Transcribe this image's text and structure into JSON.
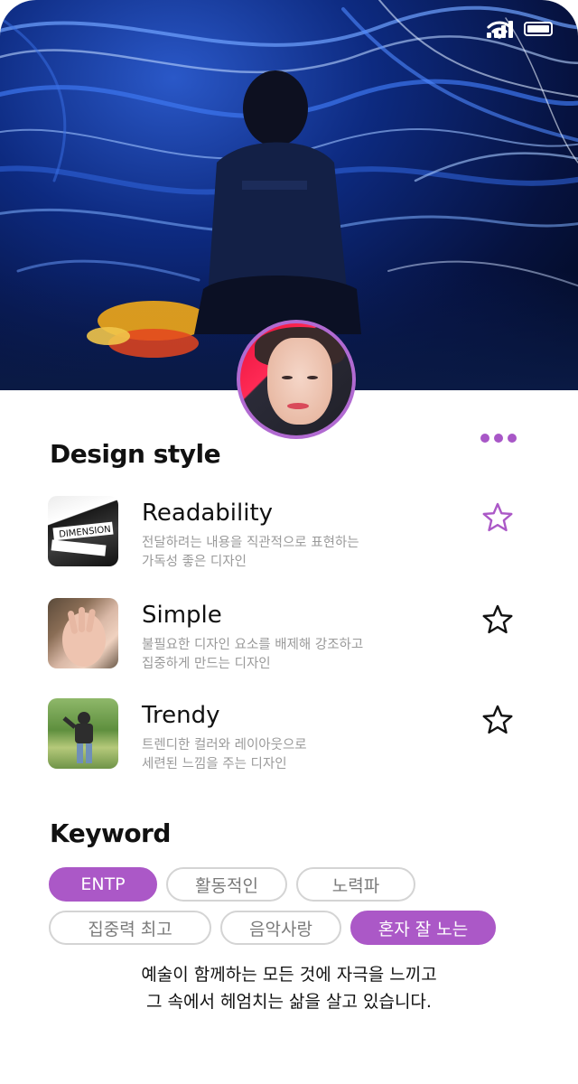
{
  "status_bar": {
    "icons": [
      "signal-icon",
      "wifi-icon",
      "battery-icon"
    ]
  },
  "hero": {
    "image": "starry-night-projection-photo"
  },
  "profile": {
    "avatar": "profile-photo",
    "more_icon": "more-dots-icon"
  },
  "design_style": {
    "title": "Design style",
    "items": [
      {
        "title": "Readability",
        "desc": "전달하려는 내용을 직관적으로 표현하는\n가독성 좋은 디자인",
        "starred": true,
        "icon": "star-icon"
      },
      {
        "title": "Simple",
        "desc": "불필요한 디자인 요소를 배제해 강조하고\n집중하게 만드는 디자인",
        "starred": false,
        "icon": "star-icon"
      },
      {
        "title": "Trendy",
        "desc": "트렌디한 컬러와 레이아웃으로\n세련된 느낌을 주는 디자인",
        "starred": false,
        "icon": "star-icon"
      }
    ]
  },
  "keyword": {
    "title": "Keyword",
    "chips": [
      {
        "label": "ENTP",
        "active": true
      },
      {
        "label": "활동적인",
        "active": false
      },
      {
        "label": "노력파",
        "active": false
      },
      {
        "label": "집중력 최고",
        "active": false
      },
      {
        "label": "음악사랑",
        "active": false
      },
      {
        "label": "혼자 잘 노는",
        "active": true
      }
    ]
  },
  "bio": "예술이 함께하는 모든 것에 자극을 느끼고\n그 속에서 헤엄치는 삶을 살고 있습니다.",
  "colors": {
    "accent": "#ab58c7",
    "muted_text": "#9a9a9a",
    "chip_border": "#d4d4d4"
  }
}
